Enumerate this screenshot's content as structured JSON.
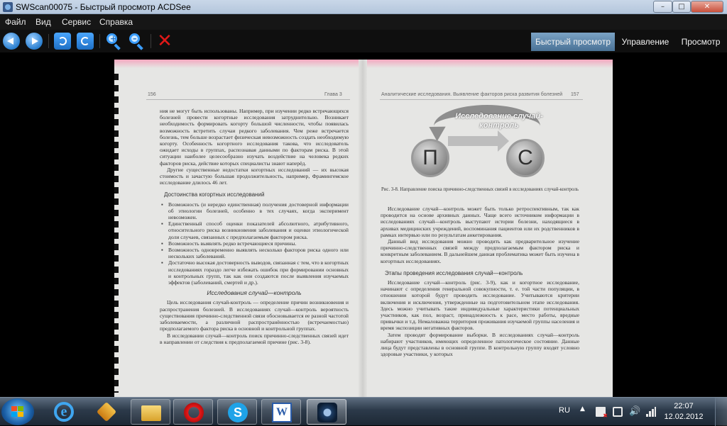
{
  "window": {
    "title": "SWScan00075 - Быстрый просмотр ACDSee",
    "min": "–",
    "max": "□",
    "close": "✕"
  },
  "menu": [
    "Файл",
    "Вид",
    "Сервис",
    "Справка"
  ],
  "toolbar": {
    "icons": [
      "back-icon",
      "forward-icon",
      "rotate-left-icon",
      "rotate-right-icon",
      "zoom-in-icon",
      "zoom-out-icon",
      "delete-icon"
    ],
    "zoom_in_sign": "+",
    "zoom_out_sign": "–",
    "delete_glyph": "✕"
  },
  "modes": {
    "quick": "Быстрый просмотр",
    "manage": "Управление",
    "view": "Просмотр",
    "active": "quick"
  },
  "document": {
    "left_page": {
      "page_number": "156",
      "chapter": "Глава 3",
      "para1": "ния не могут быть использованы. Например, при изучении редко встречающихся болезней провести когортные исследования затруднительно. Возникает необходимость формировать когорту большой численности, чтобы появилась возможность встретить случаи редкого заболевания. Чем реже встречается болезнь, тем больше возрастает физическая невозможность создать необходимую когорту. Особенность когортного исследования такова, что исследователь ожидает исходы в группах, распознавая данными по факторам риска. В этой ситуации наиболее целесообразно изучать воздействие на человека редких факторов риска, действие которых специалисты знают наперёд.",
      "para2": "Другие существенные недостатки когортных исследований — их высокая стоимость и зачастую большая продолжительность, например, Фрамингемское исследование длилось 46 лет.",
      "heading_adv": "Достоинства когортных исследований",
      "bullets": [
        "Возможность (и нередко единственная) получения достоверной информации об этиологии болезней, особенно в тех случаях, когда эксперимент невозможен.",
        "Единственный способ оценки показателей абсолютного, атрибутивного, относительного риска возникновения заболевания и оценки этиологической доли случаев, связанных с предполагаемым фактором риска.",
        "Возможность выявлять редко встречающиеся причины.",
        "Возможность одновременно выявлять несколько факторов риска одного или нескольких заболеваний.",
        "Достаточно высокая достоверность выводов, связанная с тем, что в когортных исследованиях гораздо легче избежать ошибок при формировании основных и контрольных групп, так как они создаются после выявления изучаемых эффектов (заболеваний, смертей и др.)."
      ],
      "heading_cc": "Исследования случай—контроль",
      "para3": "Цель исследования случай-контроль — определение причин возникновения и распространения болезней. В исследованиях случай—контроль вероятность существования причинно-следственной связи обосновывается ее разной частотой заболеваемости, а различной распространённостью (встречаемостью) предполагаемого фактора риска в основной и контрольной группах.",
      "para4": "В исследовании случай—контроль поиск причинно-следственных связей идет в направлении от следствия к предполагаемой причине (рис. 3-8)."
    },
    "right_page": {
      "header": "Аналитические исследования. Выявление факторов риска развития болезней",
      "page_number": "157",
      "figure_title": "Исследование случай-контроль",
      "circle_left": "П",
      "circle_right": "С",
      "caption": "Рис. 3-8. Направление поиска причинно-следственных связей в исследованиях случай-контроль",
      "para1": "Исследование случай—контроль может быть только ретроспективным, так как проводится на основе архивных данных. Чаще всего источником информации в исследованиях случай—контроль выступают истории болезни, находящиеся в архивах медицинских учреждений, воспоминания пациентов или их родственников в рамках интервью или по результатам анкетирования.",
      "para2": "Данный вид исследования можно проводить как предварительное изучение причинно-следственных связей между предполагаемым фактором риска и конкретным заболеванием. В дальнейшем данная проблематика может быть изучена в когортных исследованиях.",
      "heading_stages": "Этапы проведения исследования случай—контроль",
      "para3": "Исследование случай—контроль (рис. 3-9), как и когортное исследование, начинают с определения генеральной совокупности, т. е. той части популяции, в отношении которой будут проводить исследование. Учитываются критерии включения и исключения, утвержденные на подготовительном этапе исследования. Здесь можно учитывать такие индивидуальные характеристики потенциальных участников, как пол, возраст, принадлежность к расе, место работы, вредные привычки и т.д. Немаловажна территория проживания изучаемой группы населения и время экспозиции негативных факторов.",
      "para4": "Затем проводят формирование выборки. В исследованиях случай—контроль набирают участников, имеющих определенное патологическое состояние. Данные лица будут представлены в основной группе. В контрольную группу входят условно здоровые участники, у которых"
    }
  },
  "taskbar": {
    "items": [
      {
        "name": "internet-explorer-icon",
        "glyph": "e",
        "state": "pinned"
      },
      {
        "name": "winamp-icon",
        "glyph": "",
        "state": "pinned"
      },
      {
        "name": "explorer-folder-icon",
        "glyph": "",
        "state": "open"
      },
      {
        "name": "opera-icon",
        "glyph": "",
        "state": "open"
      },
      {
        "name": "skype-icon",
        "glyph": "S",
        "state": "open"
      },
      {
        "name": "word-icon",
        "glyph": "W",
        "state": "open"
      },
      {
        "name": "acdsee-icon",
        "glyph": "",
        "state": "active"
      }
    ],
    "language": "RU",
    "time": "22:07",
    "date": "12.02.2012"
  }
}
